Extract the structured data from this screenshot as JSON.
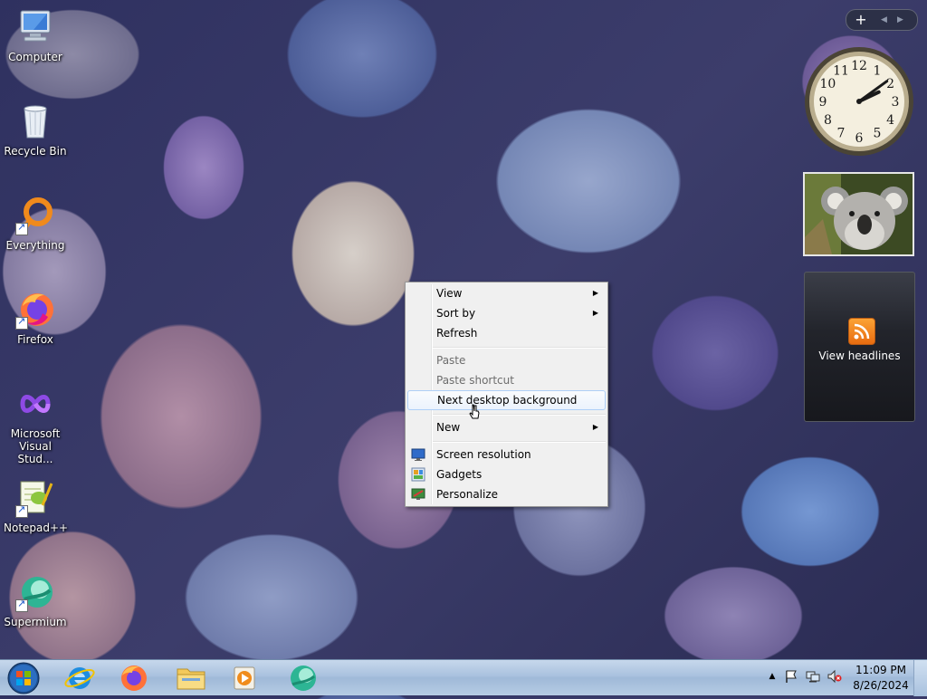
{
  "desktop_icons": [
    {
      "label": "Computer",
      "icon": "computer-icon"
    },
    {
      "label": "Recycle Bin",
      "icon": "recycle-bin-icon"
    },
    {
      "label": "Everything",
      "icon": "everything-icon"
    },
    {
      "label": "Firefox",
      "icon": "firefox-icon"
    },
    {
      "label": "Microsoft Visual Stud...",
      "icon": "visual-studio-icon"
    },
    {
      "label": "Notepad++",
      "icon": "notepadpp-icon"
    },
    {
      "label": "Supermium",
      "icon": "supermium-icon"
    }
  ],
  "context_menu": {
    "view": "View",
    "sort_by": "Sort by",
    "refresh": "Refresh",
    "paste": "Paste",
    "paste_shortcut": "Paste shortcut",
    "next_background": "Next desktop background",
    "new": "New",
    "screen_resolution": "Screen resolution",
    "gadgets": "Gadgets",
    "personalize": "Personalize"
  },
  "gadgets": {
    "add_label": "+",
    "feed_label": "View headlines"
  },
  "clock": {
    "numerals": [
      "12",
      "1",
      "2",
      "3",
      "4",
      "5",
      "6",
      "7",
      "8",
      "9",
      "10",
      "11"
    ],
    "hour": 2,
    "minute": 9
  },
  "taskbar": {
    "time": "11:09 PM",
    "date": "8/26/2024",
    "apps": [
      "internet-explorer-icon",
      "firefox-icon",
      "file-explorer-icon",
      "media-player-icon",
      "supermium-icon"
    ],
    "tray": [
      "show-hidden-icons-arrow",
      "action-center-flag-icon",
      "network-icon",
      "volume-muted-icon"
    ]
  },
  "colors": {
    "menu_bg": "#f0f0f0",
    "menu_hover_border": "#aecff7",
    "taskbar": "#a9c1de",
    "feed_orange": "#f7931e"
  }
}
